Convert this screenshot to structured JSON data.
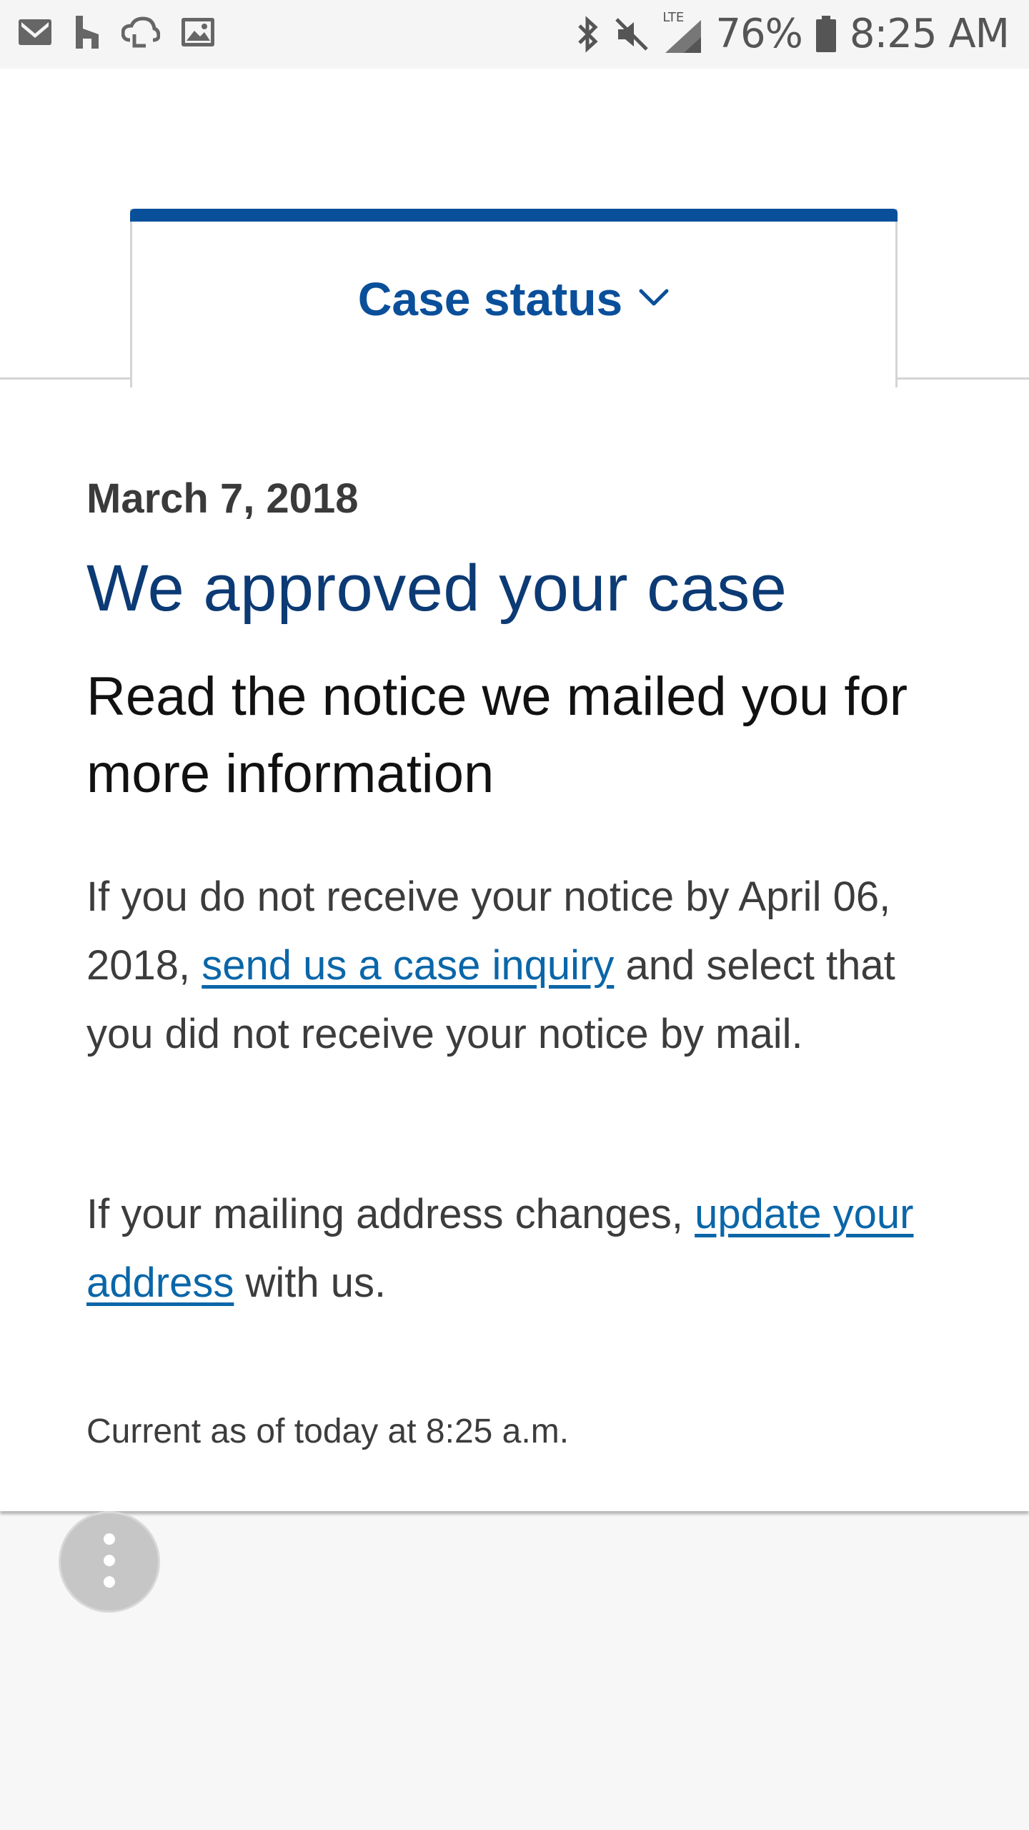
{
  "status_bar": {
    "icons_left": [
      "gmail-icon",
      "houzz-icon",
      "cloud-sync-icon",
      "image-icon"
    ],
    "icons_right": [
      "bluetooth-icon",
      "mute-icon",
      "lte-signal-icon",
      "battery-icon"
    ],
    "network_label": "LTE",
    "battery": "76%",
    "time": "8:25 AM"
  },
  "tab": {
    "label": "Case status",
    "icon": "chevron-down-icon"
  },
  "case": {
    "date": "March 7, 2018",
    "title": "We approved your case",
    "subtitle": "Read the notice we mailed you for more information",
    "para1_before": "If you do not receive your notice by April 06, 2018, ",
    "para1_link": "send us a case inquiry",
    "para1_after": " and select that you did not receive your notice by mail.",
    "para2_before": "If your mailing address changes, ",
    "para2_link": "update your address",
    "para2_after": " with us.",
    "updated": "Current as of today at 8:25 a.m."
  },
  "fab": {
    "icon": "more-vertical-icon"
  },
  "colors": {
    "accent": "#0a4f9a",
    "title": "#0c3a74",
    "link": "#0a66a8"
  }
}
